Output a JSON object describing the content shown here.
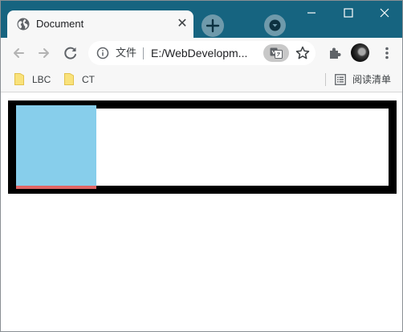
{
  "window": {
    "tab": {
      "title": "Document",
      "close_glyph": "✕"
    },
    "icons": {
      "favicon": "globe-icon",
      "new_tab": "plus-icon",
      "tab_search": "chevron-down-icon",
      "minimize": "minimize-icon",
      "maximize": "maximize-icon",
      "close": "close-icon"
    },
    "colors": {
      "titlebar": "#166480",
      "toolbar": "#f7f7f7"
    }
  },
  "toolbar": {
    "icons": {
      "back": "arrow-left-icon",
      "forward": "arrow-right-icon",
      "reload": "reload-icon",
      "site_info": "info-icon",
      "translate": "translate-icon",
      "bookmark": "star-icon",
      "extensions": "puzzle-icon",
      "menu": "more-vertical-icon"
    },
    "scheme_label": "文件",
    "url": "E:/WebDevelopm..."
  },
  "bookmarks": {
    "items": [
      {
        "label": "LBC",
        "icon": "folder-icon"
      },
      {
        "label": "CT",
        "icon": "folder-icon"
      }
    ],
    "reading_list": {
      "label": "阅读清单",
      "icon": "reading-list-icon"
    }
  },
  "page": {
    "colors": {
      "outer_border": "#000000",
      "inner_box": "#87ceeb",
      "inner_bar": "#e06666"
    }
  }
}
